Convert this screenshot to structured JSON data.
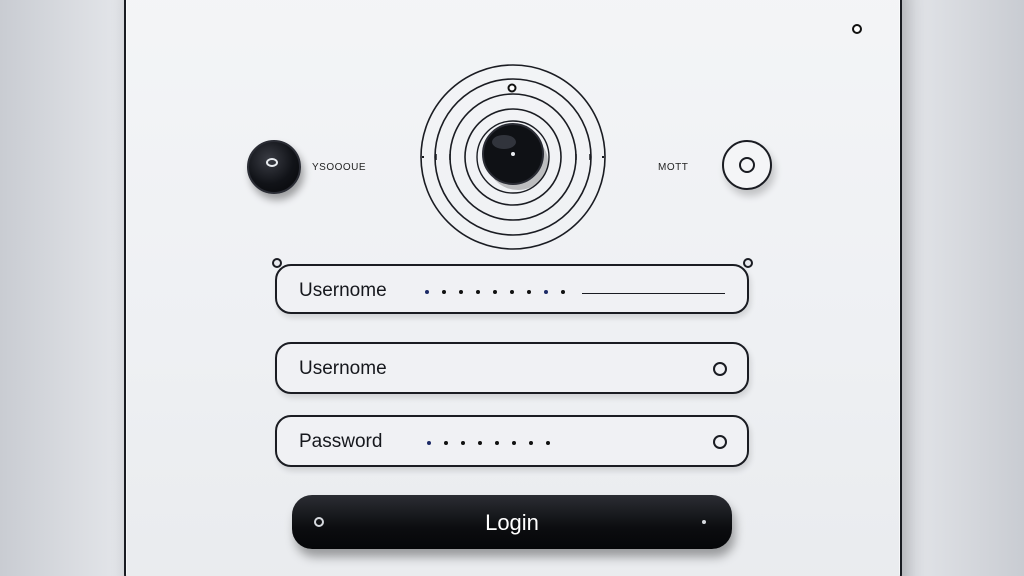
{
  "header": {
    "left_label": "YSOOOUE",
    "right_label": "MOTT"
  },
  "form": {
    "top_field_label": "Usernome",
    "username_label": "Usernome",
    "password_label": "Password",
    "login_label": "Login"
  },
  "icons": {
    "left_knob": "black-knob-icon",
    "dial": "concentric-dial-icon",
    "right_knob": "ring-knob-icon",
    "corner": "dot-icon"
  },
  "colors": {
    "panel": "#eef0f3",
    "outline": "#1a1c22",
    "button": "#0c0d10",
    "button_text": "#ffffff",
    "dot_accent": "#1c2a66"
  }
}
